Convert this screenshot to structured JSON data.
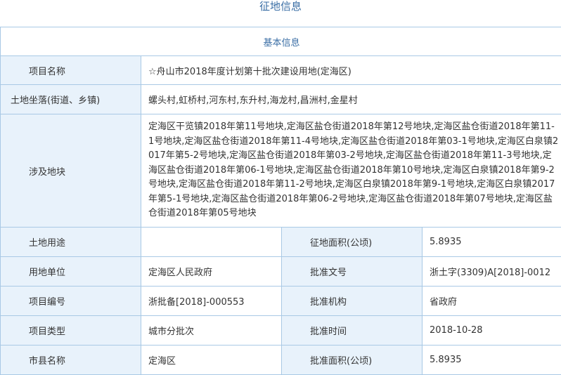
{
  "page_title": "征地信息",
  "section_title": "基本信息",
  "project_name": {
    "label": "项目名称",
    "value": "☆舟山市2018年度计划第十批次建设用地(定海区)"
  },
  "land_location": {
    "label": "土地坐落(街道、乡镇)",
    "value": "螺头村,虹桥村,河东村,东升村,海龙村,昌洲村,金星村"
  },
  "plots": {
    "label": "涉及地块",
    "value": "定海区干览镇2018年第11号地块,定海区盐仓街道2018年第12号地块,定海区盐仓街道2018年第11-1号地块,定海区盐仓街道2018年第11-4号地块,定海区盐仓街道2018年第03-1号地块,定海区白泉镇2017年第5-2号地块,定海区盐仓街道2018年第03-2号地块,定海区盐仓街道2018年第11-3号地块,定海区盐仓街道2018年第06-1号地块,定海区盐仓街道2018年第10号地块,定海区白泉镇2018年第9-2号地块,定海区盐仓街道2018年第11-2号地块,定海区白泉镇2018年第9-1号地块,定海区白泉镇2017年第5-1号地块,定海区盐仓街道2018年第06-2号地块,定海区盐仓街道2018年第07号地块,定海区盐仓街道2018年第05号地块"
  },
  "rows": [
    {
      "label1": "土地用途",
      "value1": "",
      "label2": "征地面积(公顷)",
      "value2": "5.8935"
    },
    {
      "label1": "用地单位",
      "value1": "定海区人民政府",
      "label2": "批准文号",
      "value2": "浙土字(3309)A[2018]-0012"
    },
    {
      "label1": "项目编号",
      "value1": "浙批备[2018]-000553",
      "label2": "批准机构",
      "value2": "省政府"
    },
    {
      "label1": "项目类型",
      "value1": "城市分批次",
      "label2": "批准时间",
      "value2": "2018-10-28"
    },
    {
      "label1": "市县名称",
      "value1": "定海区",
      "label2": "批准面积(公顷)",
      "value2": "5.8935"
    }
  ],
  "colors": {
    "border": "#a9c9e5",
    "label_bg": "#e8f2fb",
    "title": "#3a6ea5"
  }
}
